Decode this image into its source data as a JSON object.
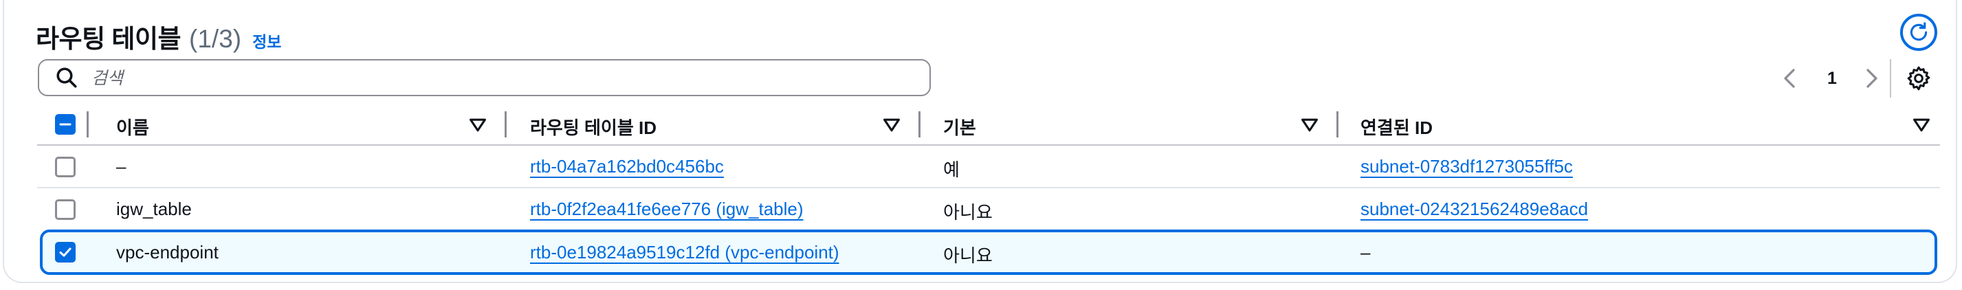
{
  "header": {
    "title": "라우팅 테이블",
    "count": "(1/3)",
    "info_link": "정보"
  },
  "search": {
    "placeholder": "검색",
    "value": ""
  },
  "pagination": {
    "current_page": "1"
  },
  "table": {
    "columns": [
      {
        "label": "이름"
      },
      {
        "label": "라우팅 테이블 ID"
      },
      {
        "label": "기본"
      },
      {
        "label": "연결된 ID"
      }
    ],
    "rows": [
      {
        "selected": false,
        "name": "–",
        "route_table_id": "rtb-04a7a162bd0c456bc",
        "main": "예",
        "associated_id": "subnet-0783df1273055ff5c"
      },
      {
        "selected": false,
        "name": "igw_table",
        "route_table_id": "rtb-0f2f2ea41fe6ee776 (igw_table)",
        "main": "아니요",
        "associated_id": "subnet-024321562489e8acd"
      },
      {
        "selected": true,
        "name": "vpc-endpoint",
        "route_table_id": "rtb-0e19824a9519c12fd (vpc-endpoint)",
        "main": "아니요",
        "associated_id": "–"
      }
    ]
  },
  "icons": {
    "refresh": "refresh-icon",
    "search": "search-icon",
    "settings": "gear-icon",
    "prev": "chevron-left-icon",
    "next": "chevron-right-icon",
    "sort": "caret-down-icon"
  },
  "colors": {
    "accent": "#006ce0",
    "selected_row_bg": "#f0fbff",
    "text": "#0f141a"
  }
}
